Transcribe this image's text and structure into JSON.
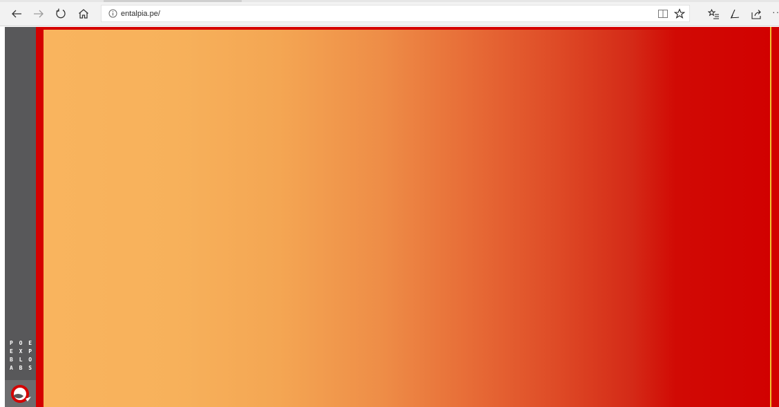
{
  "browser": {
    "url": "entalpia.pe/",
    "nav": {
      "back_icon": "arrow-left-icon",
      "forward_icon": "arrow-right-icon",
      "refresh_icon": "refresh-icon",
      "home_icon": "home-icon"
    },
    "url_actions": [
      "reading-view-icon",
      "favorite-star-icon"
    ],
    "toolbar": [
      "favorites-hub-icon",
      "pen-ink-icon",
      "share-icon",
      "more-icon"
    ],
    "more_label": "··"
  },
  "page": {
    "logo_lines": [
      "P O E",
      "E X P",
      "B L O",
      "A B S"
    ],
    "colors": {
      "rail": "#58585a",
      "border_red": "#d40000",
      "gradient_start": "#f9b45e",
      "gradient_end": "#d10000",
      "accent_line": "#f0c030"
    }
  }
}
